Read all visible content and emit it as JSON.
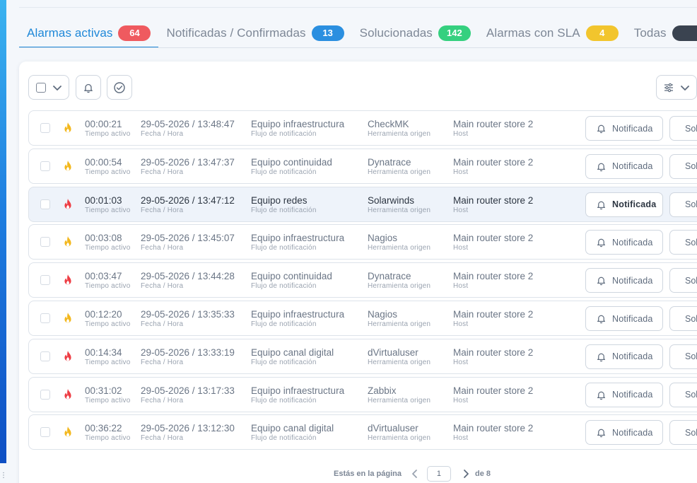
{
  "tabs": [
    {
      "label": "Alarmas activas",
      "count": "64",
      "color": "#ef5a5f",
      "active": true
    },
    {
      "label": "Notificadas / Confirmadas",
      "count": "13",
      "color": "#2b8fe0",
      "active": false
    },
    {
      "label": "Solucionadas",
      "count": "142",
      "color": "#35d07f",
      "active": false
    },
    {
      "label": "Alarmas con SLA",
      "count": "4",
      "color": "#f2c52d",
      "active": false
    },
    {
      "label": "Todas",
      "count": "",
      "color": "#3a4350",
      "active": false
    }
  ],
  "columns": {
    "time": "Tiempo activo",
    "date": "Fecha / Hora",
    "flow": "Flujo de notificación",
    "tool": "Herramienta origen",
    "host": "Host"
  },
  "actions": {
    "notify": "Notificada",
    "confirm": "Solucionada"
  },
  "rows": [
    {
      "time": "00:00:21",
      "date": "29-05-2026 / 13:48:47",
      "flow": "Equipo infraestructura",
      "tool": "CheckMK",
      "host": "Main router store 2",
      "severity": "warning",
      "highlight": false
    },
    {
      "time": "00:00:54",
      "date": "29-05-2026 / 13:47:37",
      "flow": "Equipo continuidad",
      "tool": "Dynatrace",
      "host": "Main router store 2",
      "severity": "warning",
      "highlight": false
    },
    {
      "time": "00:01:03",
      "date": "29-05-2026 / 13:47:12",
      "flow": "Equipo redes",
      "tool": "Solarwinds",
      "host": "Main router store 2",
      "severity": "critical",
      "highlight": true
    },
    {
      "time": "00:03:08",
      "date": "29-05-2026 / 13:45:07",
      "flow": "Equipo infraestructura",
      "tool": "Nagios",
      "host": "Main router store 2",
      "severity": "warning",
      "highlight": false
    },
    {
      "time": "00:03:47",
      "date": "29-05-2026 / 13:44:28",
      "flow": "Equipo continuidad",
      "tool": "Dynatrace",
      "host": "Main router store 2",
      "severity": "critical",
      "highlight": false
    },
    {
      "time": "00:12:20",
      "date": "29-05-2026 / 13:35:33",
      "flow": "Equipo infraestructura",
      "tool": "Nagios",
      "host": "Main router store 2",
      "severity": "warning",
      "highlight": false
    },
    {
      "time": "00:14:34",
      "date": "29-05-2026 / 13:33:19",
      "flow": "Equipo canal digital",
      "tool": "dVirtualuser",
      "host": "Main router store 2",
      "severity": "critical",
      "highlight": false
    },
    {
      "time": "00:31:02",
      "date": "29-05-2026 / 13:17:33",
      "flow": "Equipo infraestructura",
      "tool": "Zabbix",
      "host": "Main router store 2",
      "severity": "critical",
      "highlight": false
    },
    {
      "time": "00:36:22",
      "date": "29-05-2026 / 13:12:30",
      "flow": "Equipo canal digital",
      "tool": "dVirtualuser",
      "host": "Main router store 2",
      "severity": "warning",
      "highlight": false
    }
  ],
  "colors": {
    "warning": "#f3b81e",
    "critical": "#ee3e45",
    "accent": "#1f88d8"
  },
  "pagination": {
    "label": "Estás en la página",
    "current": "1",
    "of_label": "de 8"
  }
}
